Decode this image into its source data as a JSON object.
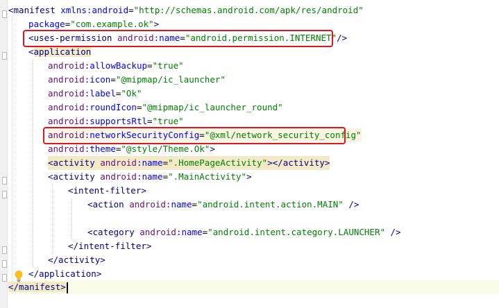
{
  "colors": {
    "tag": "#000080",
    "attribute": "#0000ff",
    "namespace": "#660e7a",
    "value": "#008000",
    "highlight_box": "#e0141e"
  },
  "icons": [
    "lightbulb-icon",
    "fold-marker-icon"
  ],
  "code": {
    "l0": {
      "tag_open": "<manifest",
      "ns": " xmlns:android",
      "eq": "=",
      "val": "\"http://schemas.android.com/apk/res/android\""
    },
    "l1": {
      "attr": "package",
      "eq": "=",
      "val": "\"com.example.ok\"",
      "end": ">"
    },
    "l2": {
      "tag_open": "<uses-permission",
      "ns": "android",
      "colon": ":",
      "attr": "name",
      "eq": "=",
      "val": "\"android.permission.INTERNET\"",
      "end": "/>"
    },
    "l3": {
      "lt": "<",
      "tag": "application"
    },
    "l4": {
      "ns": "android",
      "colon": ":",
      "attr": "allowBackup",
      "eq": "=",
      "val": "\"true\""
    },
    "l5": {
      "ns": "android",
      "colon": ":",
      "attr": "icon",
      "eq": "=",
      "val": "\"@mipmap/ic_launcher\""
    },
    "l6": {
      "ns": "android",
      "colon": ":",
      "attr": "label",
      "eq": "=",
      "val": "\"Ok\""
    },
    "l7": {
      "ns": "android",
      "colon": ":",
      "attr": "roundIcon",
      "eq": "=",
      "val": "\"@mipmap/ic_launcher_round\""
    },
    "l8": {
      "ns": "android",
      "colon": ":",
      "attr": "supportsRtl",
      "eq": "=",
      "val": "\"true\""
    },
    "l9": {
      "ns": "android",
      "colon": ":",
      "attr": "networkSecurityConfig",
      "eq": "=",
      "val": "\"@xml/network_security_config\""
    },
    "l10": {
      "ns": "android",
      "colon": ":",
      "attr": "theme",
      "eq": "=",
      "val": "\"@style/Theme.Ok\"",
      "end": ">"
    },
    "l11": {
      "tag_open": "<activity",
      "ns": "android",
      "colon": ":",
      "attr": "name",
      "eq": "=",
      "val": "\".HomePageActivity\"",
      "end": "></activity>"
    },
    "l12": {
      "tag_open": "<activity",
      "ns": "android",
      "colon": ":",
      "attr": "name",
      "eq": "=",
      "val": "\".MainActivity\"",
      "end": ">"
    },
    "l13": {
      "tag": "<intent-filter>"
    },
    "l14": {
      "tag_open": "<action",
      "ns": "android",
      "colon": ":",
      "attr": "name",
      "eq": "=",
      "val": "\"android.intent.action.MAIN\"",
      "end": " />"
    },
    "l16": {
      "tag_open": "<category",
      "ns": "android",
      "colon": ":",
      "attr": "name",
      "eq": "=",
      "val": "\"android.intent.category.LAUNCHER\"",
      "end": " />"
    },
    "l17": {
      "tag": "</intent-filter>"
    },
    "l18": {
      "tag": "</activity>"
    },
    "l19": {
      "tag": "</application>"
    },
    "l20": {
      "tag": "</manifest>"
    }
  }
}
